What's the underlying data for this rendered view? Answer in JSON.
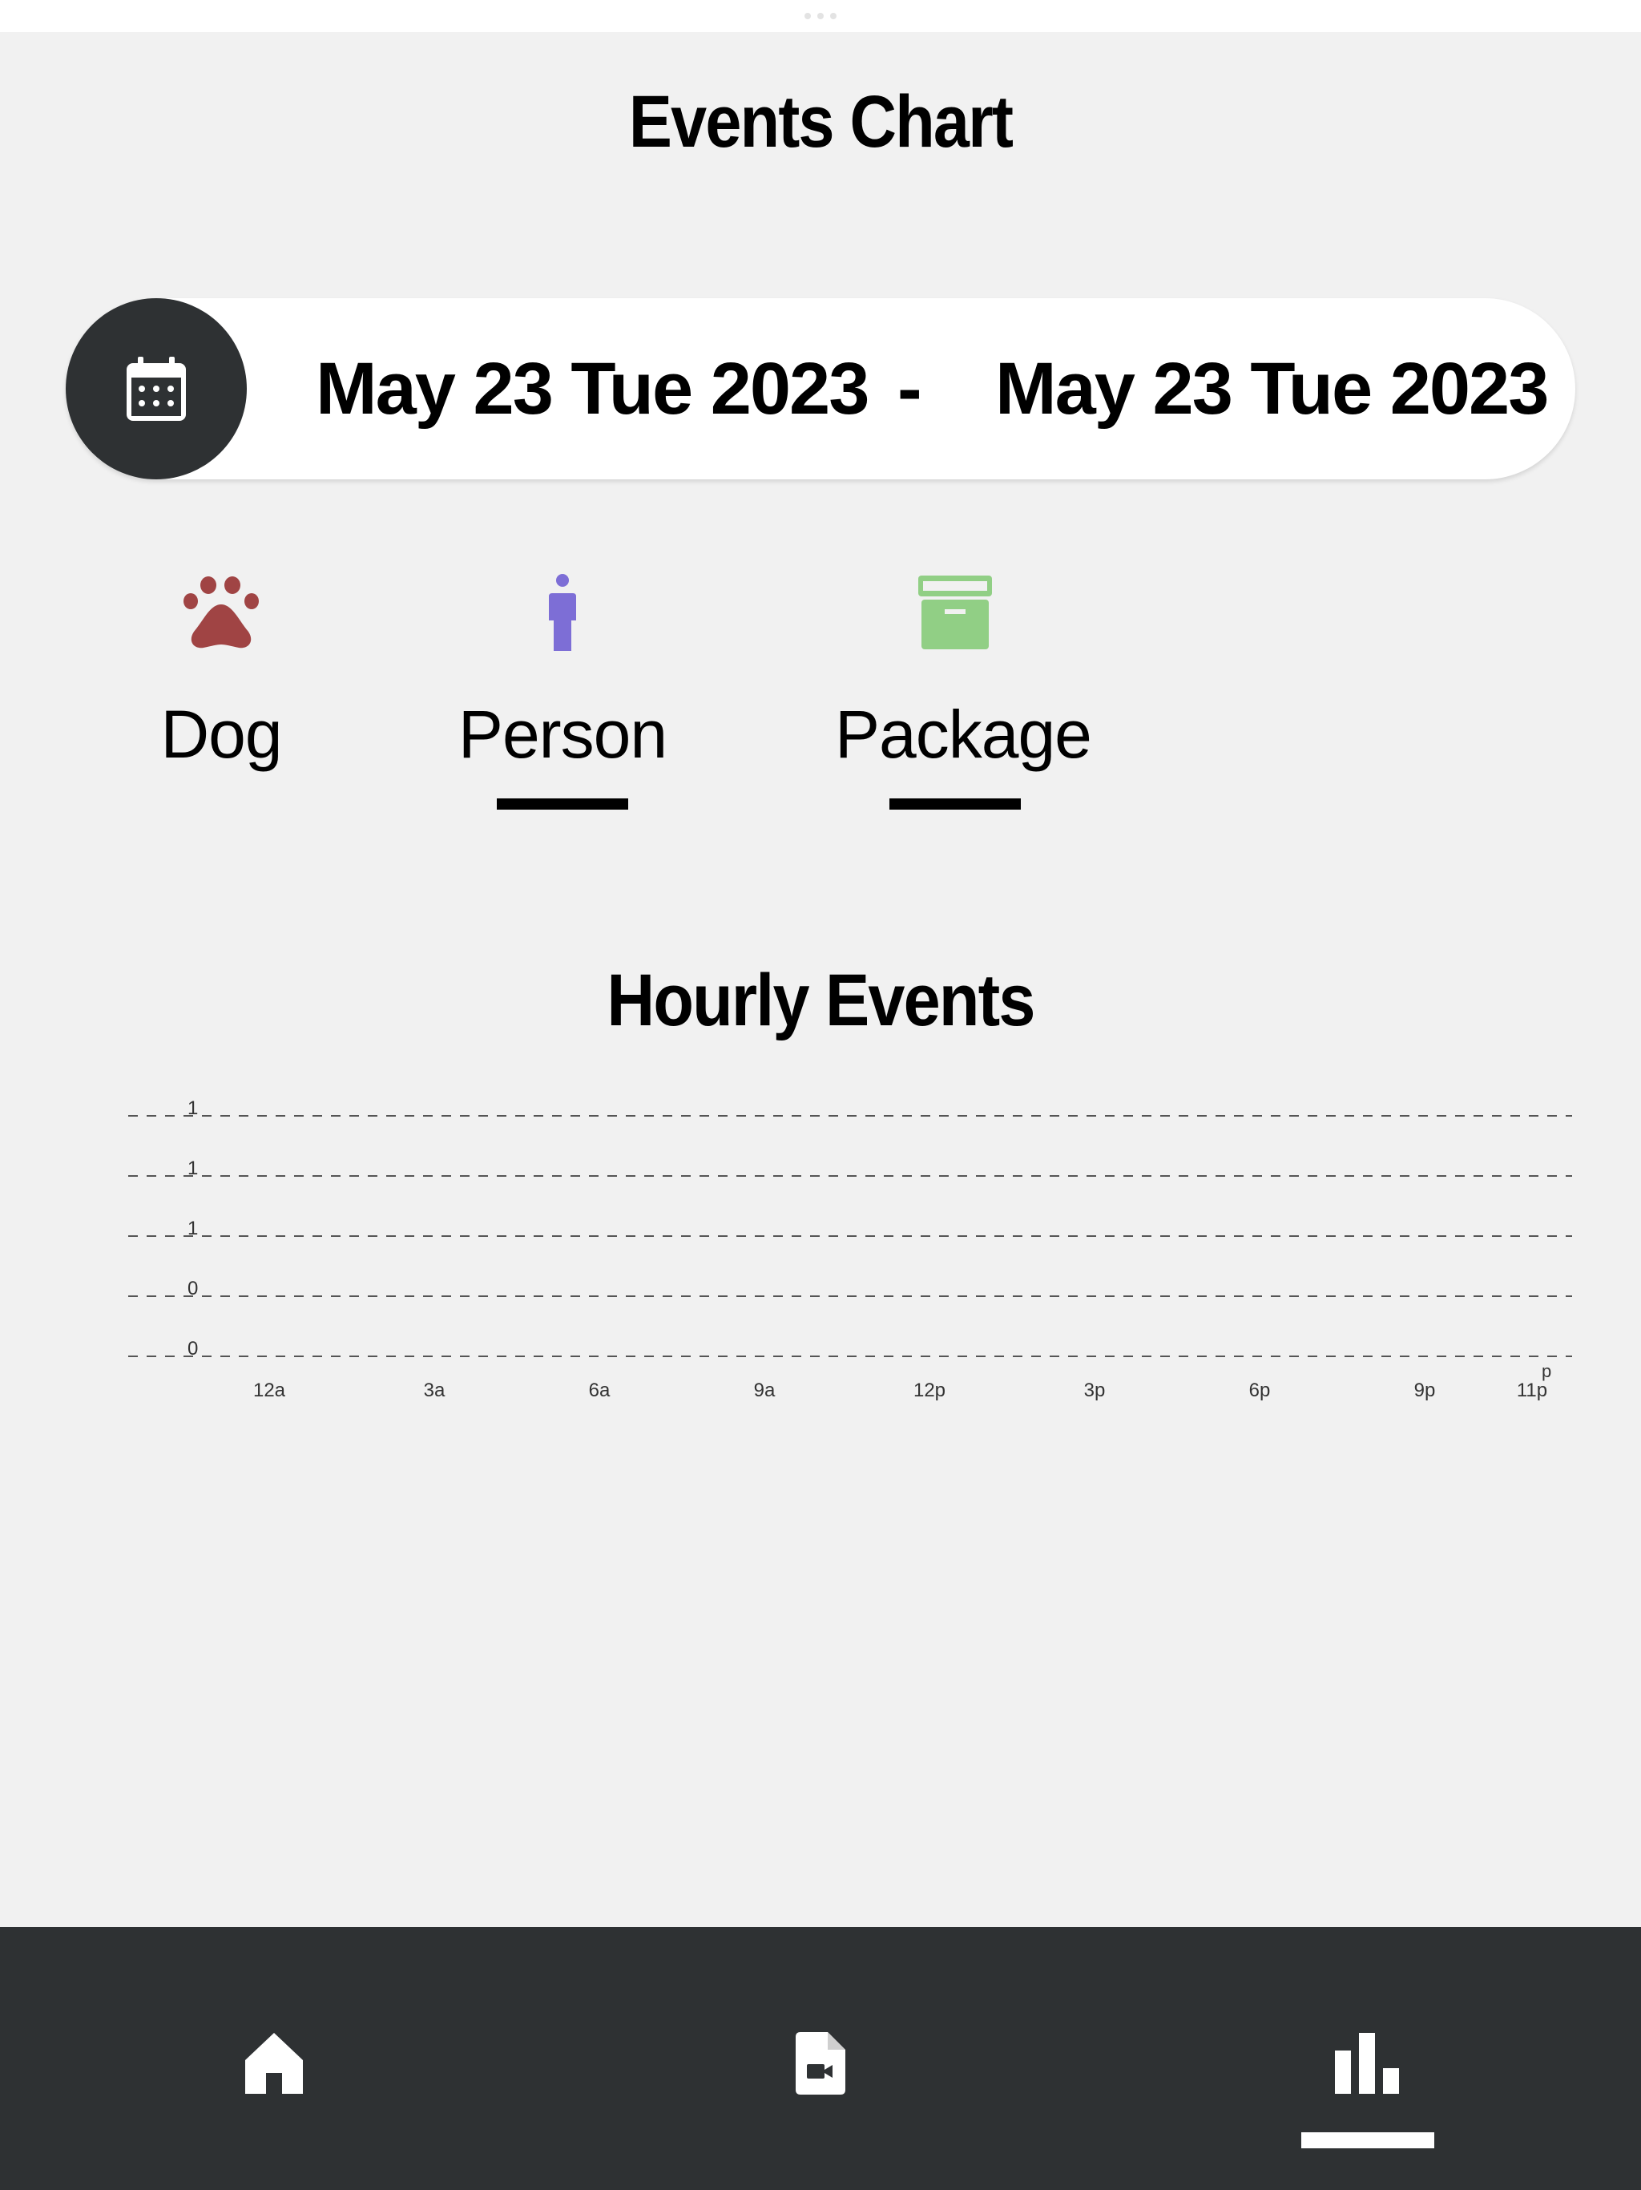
{
  "header": {
    "title": "Events Chart"
  },
  "date_range": {
    "start": "May 23 Tue 2023",
    "separator": "-",
    "end": "May 23 Tue 2023",
    "calendar_icon": "calendar-icon"
  },
  "filters": [
    {
      "label": "Dog",
      "icon": "paw-icon",
      "color": "#a04444",
      "selected": false
    },
    {
      "label": "Person",
      "icon": "person-icon",
      "color": "#7d6ed6",
      "selected": true
    },
    {
      "label": "Package",
      "icon": "package-icon",
      "color": "#91cf85",
      "selected": true
    }
  ],
  "chart": {
    "title": "Hourly Events"
  },
  "chart_data": {
    "type": "bar",
    "title": "Hourly Events",
    "x": [
      "12a",
      "3a",
      "6a",
      "9a",
      "12p",
      "3p",
      "6p",
      "9p",
      "11p"
    ],
    "stray_label": "p",
    "y_ticks": [
      "1",
      "1",
      "1",
      "0",
      "0"
    ],
    "series": [],
    "grid": true
  },
  "nav": {
    "items": [
      {
        "name": "home",
        "icon": "home-icon"
      },
      {
        "name": "recordings",
        "icon": "video-file-icon"
      },
      {
        "name": "chart",
        "icon": "bar-chart-icon",
        "active": true
      }
    ]
  }
}
